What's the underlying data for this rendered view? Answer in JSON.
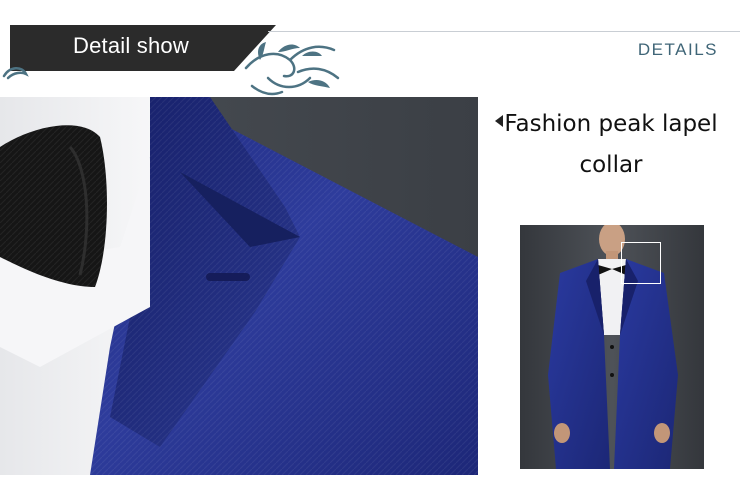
{
  "header": {
    "title": "Detail show",
    "section_label": "DETAILS"
  },
  "feature": {
    "caption": "Fashion peak lapel collar"
  },
  "colors": {
    "header_tab": "#2b2b2b",
    "accent_teal": "#3f6577",
    "suit_blue": "#2b3a94",
    "shirt_white": "#f4f4f6"
  },
  "icons": [
    "arrow-left-icon",
    "swirl-ornament-icon"
  ]
}
